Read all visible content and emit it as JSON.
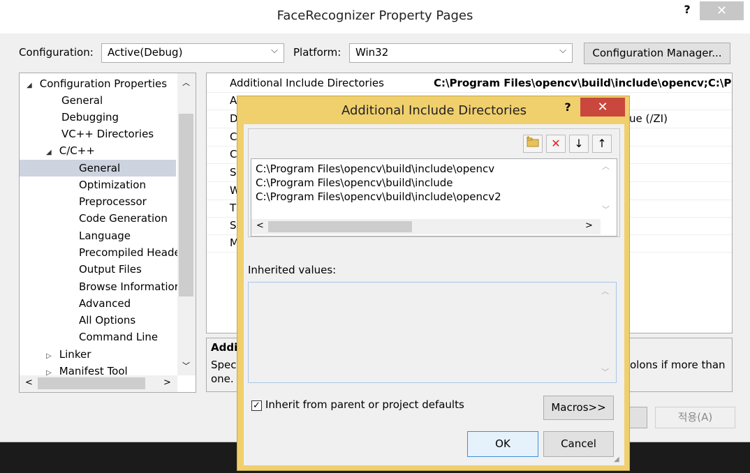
{
  "outer": {
    "title": "FaceRecognizer Property Pages",
    "help": "?",
    "close": "✕",
    "configuration_label": "Configuration:",
    "configuration_value": "Active(Debug)",
    "platform_label": "Platform:",
    "platform_value": "Win32",
    "config_manager": "Configuration Manager...",
    "apply": "적용(A)"
  },
  "tree": {
    "items": [
      "Configuration Properties",
      "General",
      "Debugging",
      "VC++ Directories",
      "C/C++",
      "General",
      "Optimization",
      "Preprocessor",
      "Code Generation",
      "Language",
      "Precompiled Heade",
      "Output Files",
      "Browse Informatior",
      "Advanced",
      "All Options",
      "Command Line",
      "Linker",
      "Manifest Tool"
    ]
  },
  "grid": {
    "first_name": "Additional Include Directories",
    "first_value": "C:\\Program Files\\opencv\\build\\include\\opencv;C:\\P",
    "row_letters": [
      "A",
      "D",
      "C",
      "C",
      "S",
      "W",
      "Tı",
      "S",
      "M"
    ],
    "value_fragment": "ue (/ZI)"
  },
  "desc": {
    "title": "Addi",
    "text_left": "Speci",
    "text_left2": "one.",
    "text_right": "olons if more than"
  },
  "dialog": {
    "title": "Additional Include Directories",
    "help": "?",
    "close": "✕",
    "entries": [
      "C:\\Program Files\\opencv\\build\\include\\opencv",
      "C:\\Program Files\\opencv\\build\\include",
      "C:\\Program Files\\opencv\\build\\include\\opencv2"
    ],
    "inherited_label": "Inherited values:",
    "inherit_checkbox": "Inherit from parent or project defaults",
    "macros": "Macros>>",
    "ok": "OK",
    "cancel": "Cancel"
  },
  "icons": {
    "new_line": "folder-new-icon",
    "delete": "delete-icon",
    "move_down": "arrow-down-icon",
    "move_up": "arrow-up-icon"
  },
  "colors": {
    "dialog_frame": "#f0cf6d",
    "close_red": "#c9473d",
    "selected_tree": "#cce8ff"
  }
}
